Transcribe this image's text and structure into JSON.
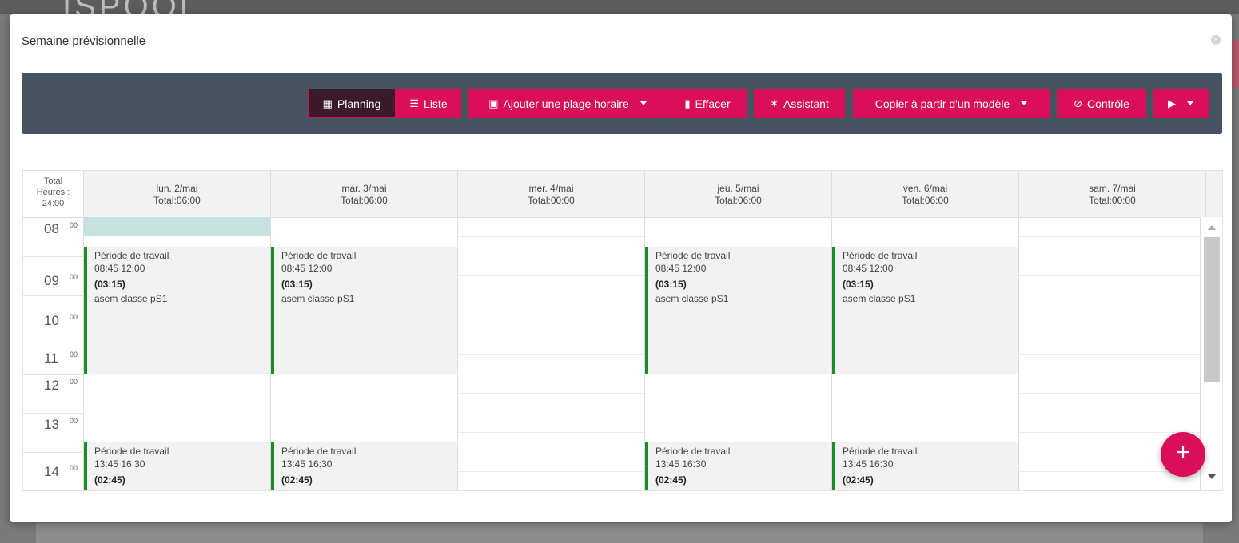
{
  "modal": {
    "title": "Semaine prévisionnelle"
  },
  "toolbar": {
    "planning": "Planning",
    "liste": "Liste",
    "ajouter": "Ajouter une plage horaire",
    "effacer": "Effacer",
    "assistant": "Assistant",
    "copier": "Copier à partir d'un modèle",
    "controle": "Contrôle"
  },
  "calendar": {
    "total_line1": "Total",
    "total_line2": "Heures :",
    "total_line3": "24:00",
    "days": [
      {
        "name": "lun. 2/mai",
        "total": "Total:06:00"
      },
      {
        "name": "mar. 3/mai",
        "total": "Total:06:00"
      },
      {
        "name": "mer. 4/mai",
        "total": "Total:00:00"
      },
      {
        "name": "jeu. 5/mai",
        "total": "Total:06:00"
      },
      {
        "name": "ven. 6/mai",
        "total": "Total:06:00"
      },
      {
        "name": "sam. 7/mai",
        "total": "Total:00:00"
      }
    ],
    "hours": [
      "08",
      "09",
      "10",
      "11",
      "12",
      "13",
      "14"
    ],
    "minute_label": "00",
    "morning_event": {
      "title": "Période de travail",
      "time": "08:45 12:00",
      "duration": "(03:15)",
      "label": "asem classe pS1"
    },
    "afternoon_event": {
      "title": "Période de travail",
      "time": "13:45 16:30",
      "duration": "(02:45)"
    }
  },
  "fab": {
    "symbol": "+"
  },
  "colors": {
    "accent": "#d90f5a",
    "toolbar": "#465462",
    "event_border": "#1c8a26"
  }
}
